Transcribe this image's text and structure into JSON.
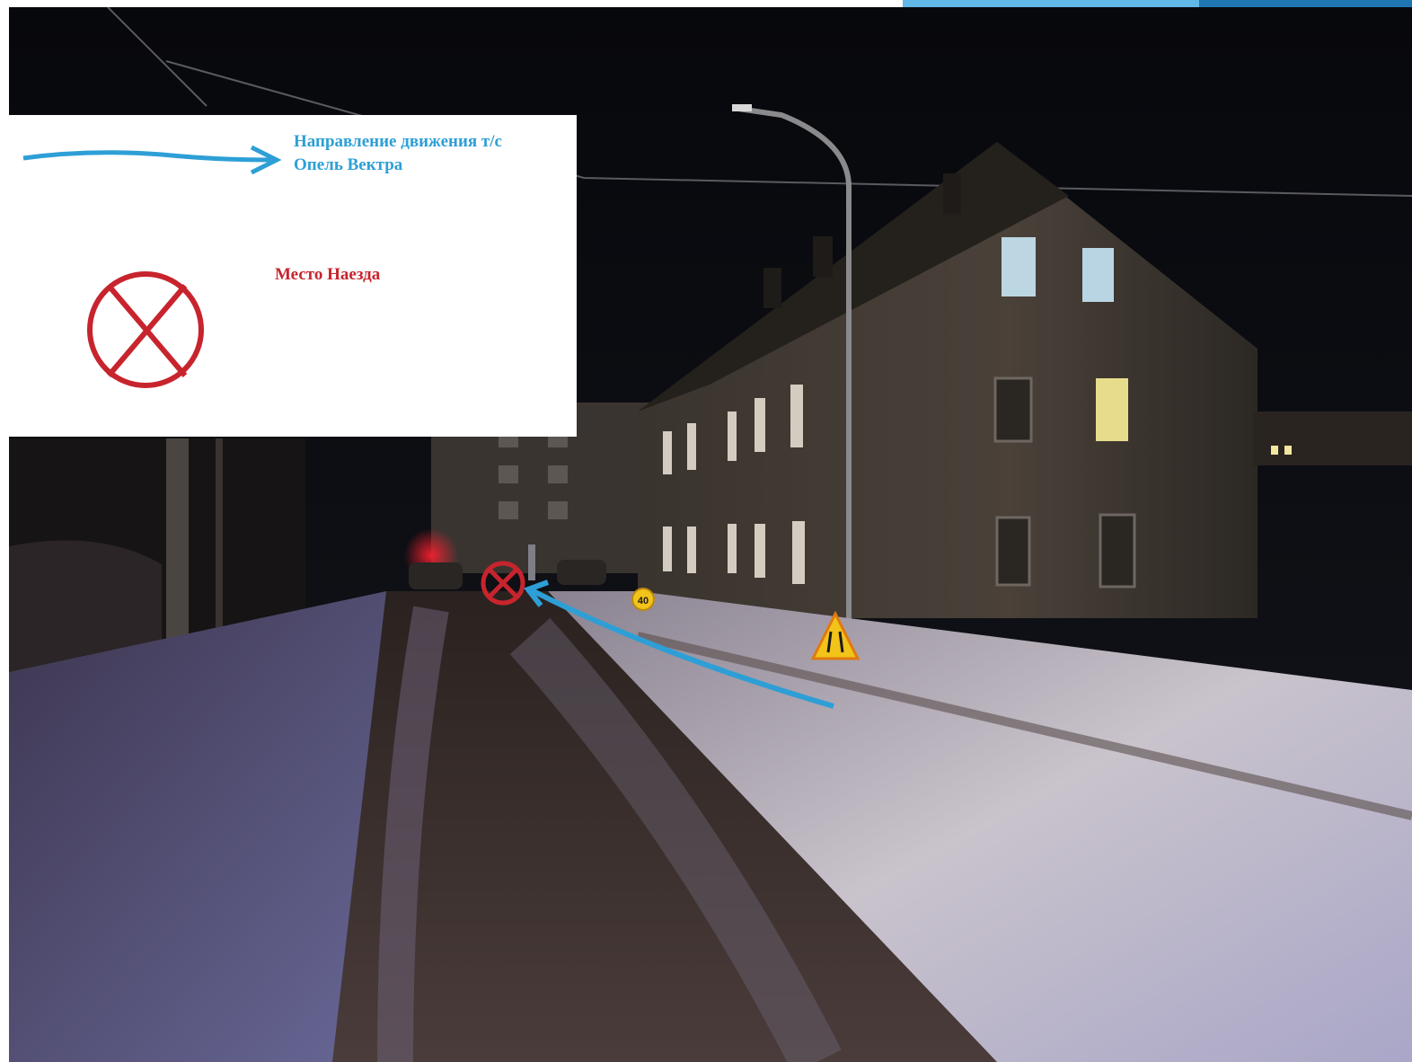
{
  "legend": {
    "direction_line1": "Направление движения т/с",
    "direction_line2": "Опель Вектра",
    "impact_label": "Место Наезда"
  },
  "scene": {
    "speed_sign": "40"
  },
  "colors": {
    "direction_arrow": "#2e9fd6",
    "impact_marker": "#c8242d",
    "accent_bar_light": "#5fb8e6",
    "accent_bar_dark": "#1f76b2"
  }
}
